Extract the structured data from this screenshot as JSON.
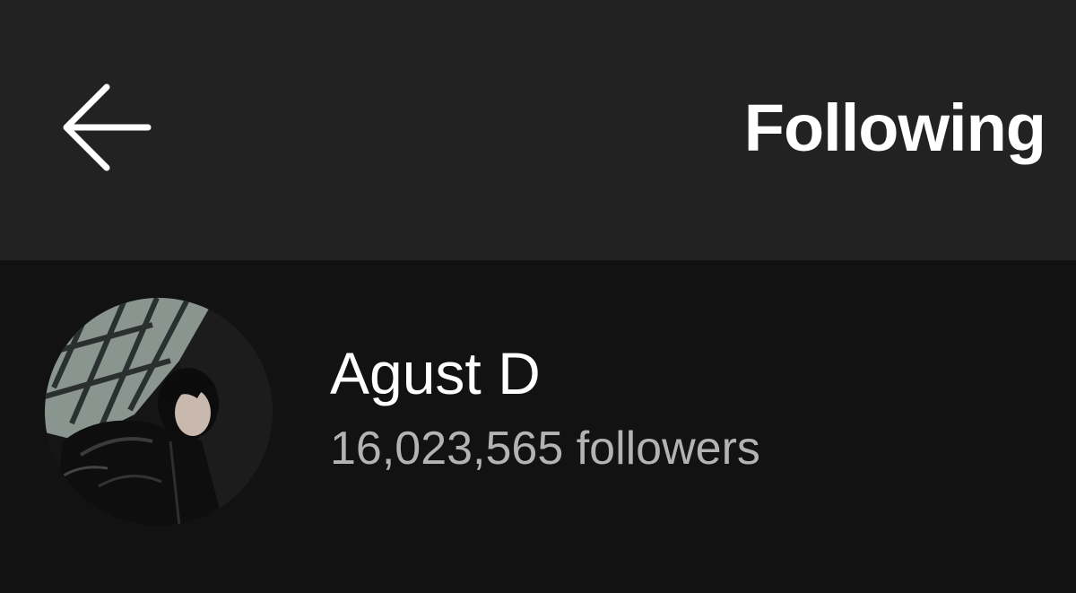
{
  "header": {
    "back_icon": "arrow-left-icon",
    "title": "Following"
  },
  "following": [
    {
      "name": "Agust D",
      "followers": "16,023,565 followers",
      "avatar": "artist-photo"
    }
  ],
  "colors": {
    "header_bg": "#222222",
    "page_bg": "#121212",
    "primary_text": "#ffffff",
    "secondary_text": "#b3b3b3"
  }
}
